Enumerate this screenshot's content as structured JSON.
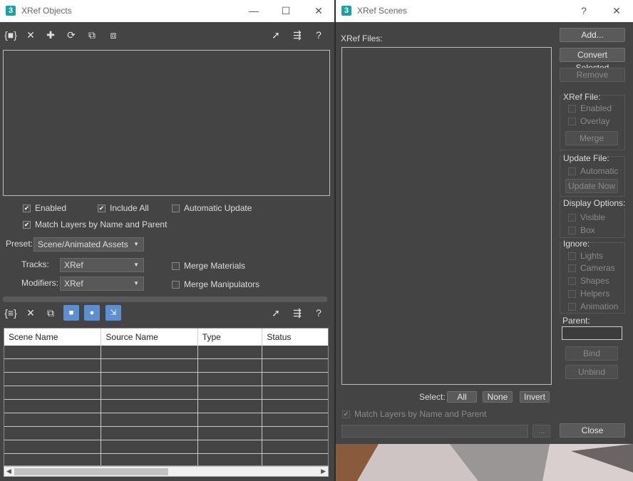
{
  "xref_objects": {
    "title": "XRef Objects",
    "window_controls": {
      "minimize": "—",
      "maximize": "☐",
      "close": "✕"
    },
    "checkboxes": {
      "enabled": {
        "label": "Enabled",
        "checked": true
      },
      "include_all": {
        "label": "Include All",
        "checked": true
      },
      "automatic_update": {
        "label": "Automatic Update",
        "checked": false
      },
      "match_layers": {
        "label": "Match Layers by Name and Parent",
        "checked": true
      },
      "merge_materials": {
        "label": "Merge Materials",
        "checked": false
      },
      "merge_manipulators": {
        "label": "Merge Manipulators",
        "checked": false
      }
    },
    "preset": {
      "label": "Preset:",
      "value": "Scene/Animated Assets"
    },
    "tracks": {
      "label": "Tracks:",
      "value": "XRef"
    },
    "modifiers": {
      "label": "Modifiers:",
      "value": "XRef"
    },
    "table": {
      "columns": [
        "Scene Name",
        "Source Name",
        "Type",
        "Status"
      ],
      "rows": []
    }
  },
  "xref_scenes": {
    "title": "XRef Scenes",
    "window_controls": {
      "help": "?",
      "close": "✕"
    },
    "xref_files_label": "XRef Files:",
    "buttons": {
      "add": "Add...",
      "convert_selected": "Convert Selected",
      "remove": "Remove",
      "merge": "Merge",
      "update_now": "Update Now",
      "bind": "Bind",
      "unbind": "Unbind",
      "close": "Close",
      "all": "All",
      "none": "None",
      "invert": "Invert",
      "browse": "..."
    },
    "xref_file_group": {
      "label": "XRef File:",
      "enabled": "Enabled",
      "overlay": "Overlay"
    },
    "update_file_group": {
      "label": "Update File:",
      "automatic": "Automatic"
    },
    "display_options_group": {
      "label": "Display Options:",
      "visible": "Visible",
      "box": "Box"
    },
    "ignore_group": {
      "label": "Ignore:",
      "items": [
        "Lights",
        "Cameras",
        "Shapes",
        "Helpers",
        "Animation"
      ]
    },
    "parent_label": "Parent:",
    "select_label": "Select:",
    "match_layers": {
      "label": "Match Layers by Name and Parent",
      "checked": true
    }
  },
  "colors": {
    "panel": "#444444",
    "titlebar": "#ffffff",
    "accent_blue": "#5b8fd1",
    "app_icon": "#1aa0a6"
  }
}
